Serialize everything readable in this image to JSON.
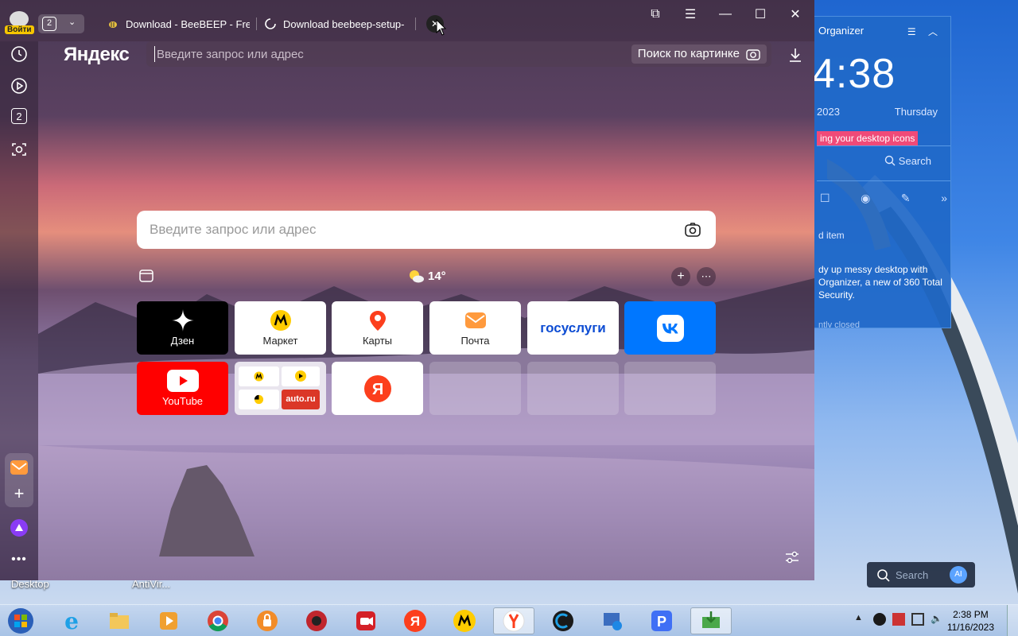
{
  "browser": {
    "login_label": "Войти",
    "tab_count": "2",
    "tabs": [
      {
        "title": "Download - BeeBEEP - Free"
      },
      {
        "title": "Download beebeep-setup-"
      }
    ],
    "logo": "Яндекс",
    "address_placeholder": "Введите запрос или адрес",
    "image_search_label": "Поиск по картинке",
    "sidebar_badge": "2"
  },
  "newtab": {
    "search_placeholder": "Введите запрос или адрес",
    "weather": "14°",
    "tiles": [
      {
        "label": "Дзен",
        "icon": "dzen-icon"
      },
      {
        "label": "Маркет",
        "icon": "market-icon"
      },
      {
        "label": "Карты",
        "icon": "maps-pin-icon"
      },
      {
        "label": "Почта",
        "icon": "mail-icon"
      },
      {
        "label": "госуслуги",
        "icon": "gosuslugi-logo"
      },
      {
        "label": "",
        "icon": "vk-icon"
      },
      {
        "label": "YouTube",
        "icon": "youtube-icon"
      },
      {
        "label": "auto.ru",
        "icon": "group-icon"
      },
      {
        "label": "",
        "icon": "yandex-icon"
      }
    ]
  },
  "organizer": {
    "title": "Organizer",
    "time": "4:38",
    "date_fragment": "2023",
    "day": "Thursday",
    "banner": "ing your desktop icons",
    "search_label": "Search",
    "item_label": "d item",
    "description": "dy up messy desktop with Organizer, a new of 360 Total Security.",
    "description_extra": "w",
    "closed_label": "ntly closed"
  },
  "desktop": {
    "labels": [
      "Desktop",
      "AntiVir..."
    ],
    "search_placeholder": "Search",
    "ai_badge": "AI"
  },
  "taskbar": {
    "time": "2:38 PM",
    "date": "11/16/2023"
  },
  "colors": {
    "taskbar": "#a8c3e6",
    "organizer": "#1f68c8",
    "youtube": "#ff0000",
    "vk": "#0077ff"
  }
}
